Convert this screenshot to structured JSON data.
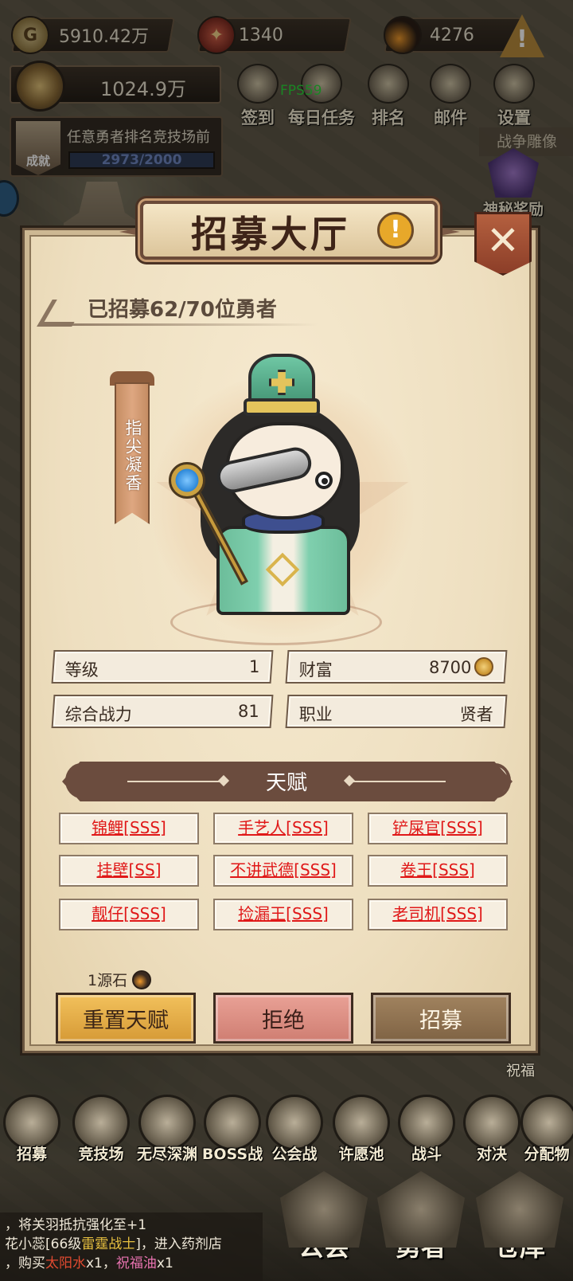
{
  "currency": {
    "gold": "5910.42万",
    "crystal": "1340",
    "stone": "4276"
  },
  "wealth": "1024.9万",
  "fps": "FPS59",
  "top_menu": [
    {
      "label": "签到",
      "icon": "sign-in-icon"
    },
    {
      "label": "每日任务",
      "icon": "daily-task-icon"
    },
    {
      "label": "排名",
      "icon": "ranking-icon"
    },
    {
      "label": "邮件",
      "icon": "mail-icon"
    },
    {
      "label": "设置",
      "icon": "settings-icon"
    }
  ],
  "achievement": {
    "badge": "成就",
    "text": "任意勇者排名竞技场前",
    "progress": "2973/2000"
  },
  "side_right": "战争雕像",
  "mystery_reward": "神秘奖励",
  "dialog": {
    "title": "招募大厅",
    "recruited": "已招募62/70位勇者",
    "hero_name": "指尖凝香",
    "stats": {
      "level_label": "等级",
      "level_value": "1",
      "wealth_label": "财富",
      "wealth_value": "8700",
      "power_label": "综合战力",
      "power_value": "81",
      "class_label": "职业",
      "class_value": "贤者"
    },
    "talent_title": "天赋",
    "talents": [
      "锦鲤[SSS]",
      "手艺人[SSS]",
      "铲屎官[SSS]",
      "挂壁[SS]",
      "不讲武德[SSS]",
      "卷王[SSS]",
      "靓仔[SSS]",
      "捡漏王[SSS]",
      "老司机[SSS]"
    ],
    "cost": "1源石",
    "buttons": {
      "reset": "重置天赋",
      "reject": "拒绝",
      "recruit": "招募"
    }
  },
  "bottom_menu": [
    {
      "label": "招募",
      "icon": "recruit-icon"
    },
    {
      "label": "竞技场",
      "icon": "arena-icon"
    },
    {
      "label": "无尽深渊",
      "icon": "abyss-icon"
    },
    {
      "label": "BOSS战",
      "icon": "boss-icon"
    },
    {
      "label": "公会战",
      "icon": "guild-war-icon"
    },
    {
      "label": "许愿池",
      "icon": "wishing-pool-icon"
    },
    {
      "label": "战斗",
      "icon": "battle-icon"
    },
    {
      "label": "对决",
      "icon": "duel-icon"
    },
    {
      "label": "分配物",
      "icon": "distribute-icon"
    }
  ],
  "chat": {
    "line1": "，将关羽抵抗强化至+1",
    "line2_user": "花小蕊",
    "line2_level": "[66级",
    "line2_class": "雷霆战士",
    "line2_rest": "]，进入药剂店",
    "line3_pre": "，购买",
    "line3_item1": "太阳水",
    "line3_mid": "x1，",
    "line3_item2": "祝福油",
    "line3_end": "x1"
  },
  "main_tabs": [
    "公会",
    "勇者",
    "仓库"
  ],
  "map_label": "祝福"
}
